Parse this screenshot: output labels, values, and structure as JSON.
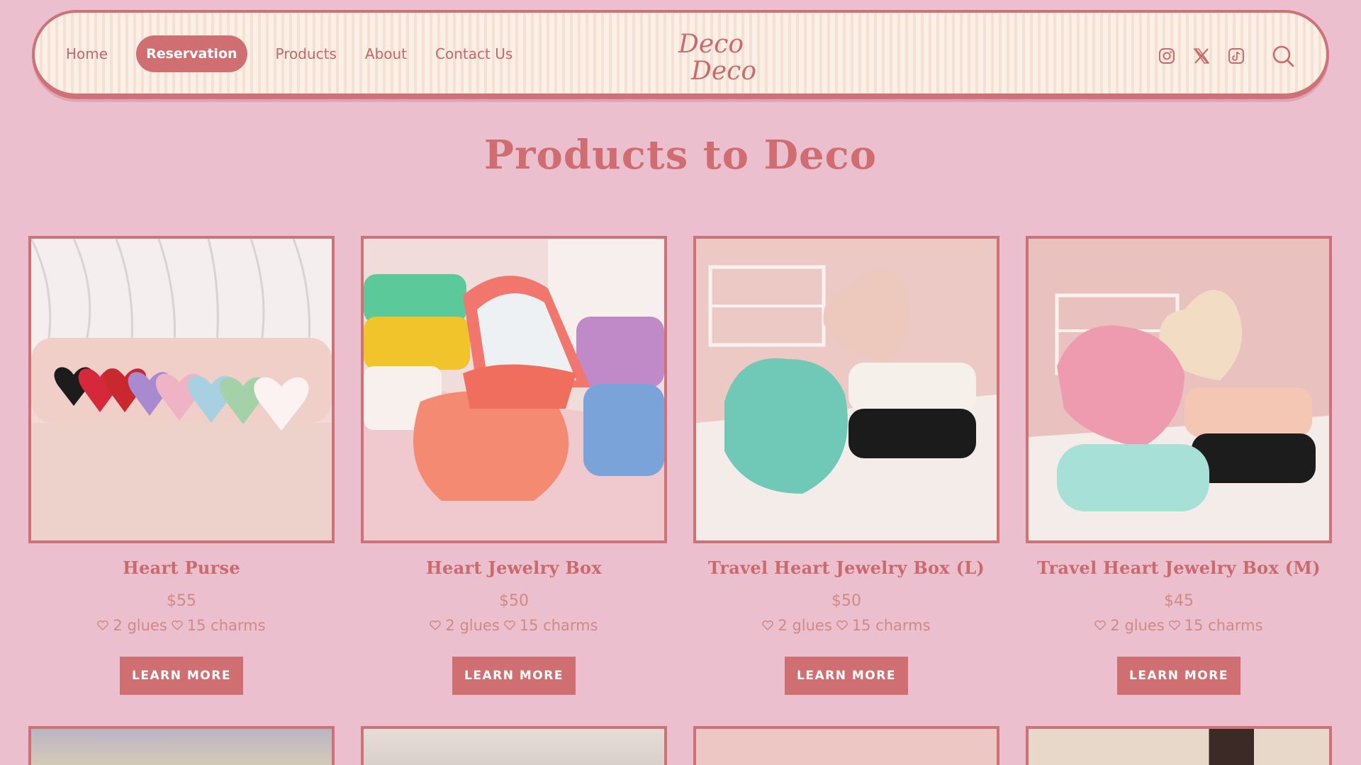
{
  "nav": {
    "links": [
      "Home",
      "Reservation",
      "Products",
      "About",
      "Contact Us"
    ],
    "active_index": 1,
    "logo_text_1": "Deco",
    "logo_text_2": "Deco",
    "icons": [
      "instagram-icon",
      "x-icon",
      "tiktok-icon",
      "search-icon"
    ]
  },
  "heading": "Products to Deco",
  "colors": {
    "background": "#ecbfcf",
    "accent": "#cf6f72",
    "nav_bg": "#fbefe6",
    "text": "#c96a6d"
  },
  "products": [
    {
      "title": "Heart Purse",
      "price": "$55",
      "glues": "2 glues",
      "charms": "15 charms",
      "button": "LEARN MORE"
    },
    {
      "title": "Heart Jewelry Box",
      "price": "$50",
      "glues": "2 glues",
      "charms": "15 charms",
      "button": "LEARN MORE"
    },
    {
      "title": "Travel Heart Jewelry Box (L)",
      "price": "$50",
      "glues": "2 glues",
      "charms": "15 charms",
      "button": "LEARN MORE"
    },
    {
      "title": "Travel Heart Jewelry Box (M)",
      "price": "$45",
      "glues": "2 glues",
      "charms": "15 charms",
      "button": "LEARN MORE"
    }
  ]
}
